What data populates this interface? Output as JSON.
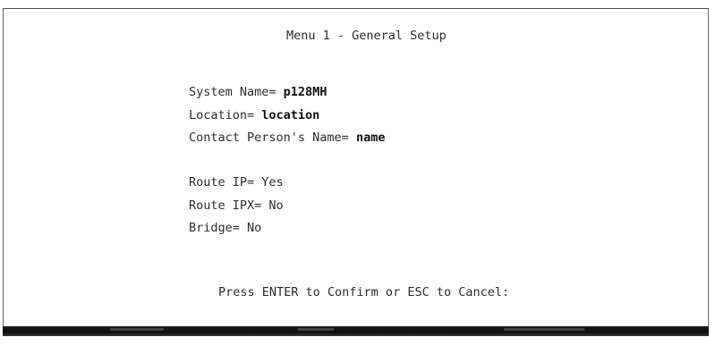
{
  "menu": {
    "title": "Menu 1 - General Setup",
    "fields": [
      {
        "label": "System Name= ",
        "value": "p128MH"
      },
      {
        "label": "Location= ",
        "value": "location"
      },
      {
        "label": "Contact Person's Name= ",
        "value": "name"
      },
      {
        "label": "Route IP= ",
        "value": "Yes"
      },
      {
        "label": "Route IPX= ",
        "value": "No"
      },
      {
        "label": "Bridge= ",
        "value": "No"
      }
    ],
    "prompt": "Press ENTER to Confirm or ESC to Cancel:"
  }
}
